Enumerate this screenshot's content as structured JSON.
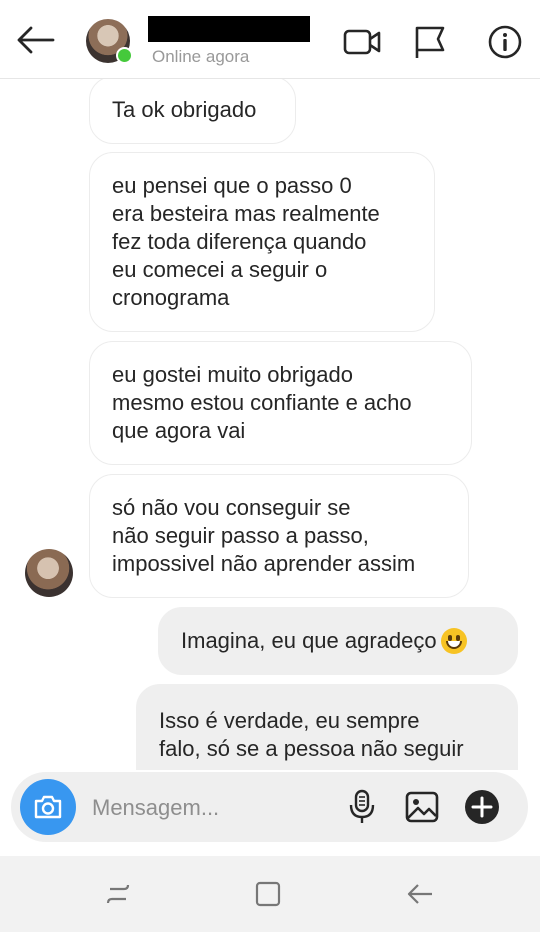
{
  "header": {
    "contact_name": "",
    "status": "Online agora"
  },
  "messages": [
    {
      "text": "Ta ok obrigado"
    },
    {
      "text": "eu pensei que o passo 0\nera besteira mas realmente\nfez toda diferença quando\neu comecei a seguir o\ncronograma"
    },
    {
      "text": "eu gostei muito obrigado\nmesmo estou confiante e acho\nque agora vai"
    },
    {
      "text": "só não vou conseguir se\nnão seguir passo a passo,\nimpossivel não aprender assim"
    },
    {
      "text": "Imagina, eu que agradeço",
      "emoji": "grinning-face"
    },
    {
      "text": "Isso é verdade, eu sempre\nfalo, só se a pessoa não seguir"
    }
  ],
  "composer": {
    "placeholder": "Mensagem...",
    "value": ""
  },
  "icons": {
    "back": "arrow-left-icon",
    "video": "video-camera-icon",
    "flag": "flag-icon",
    "info": "info-icon",
    "camera": "camera-icon",
    "mic": "microphone-icon",
    "gallery": "image-icon",
    "add": "plus-circle-icon"
  },
  "colors": {
    "online": "#45c93b",
    "camera_button": "#3897f0",
    "outgoing_bubble": "#efefef"
  }
}
